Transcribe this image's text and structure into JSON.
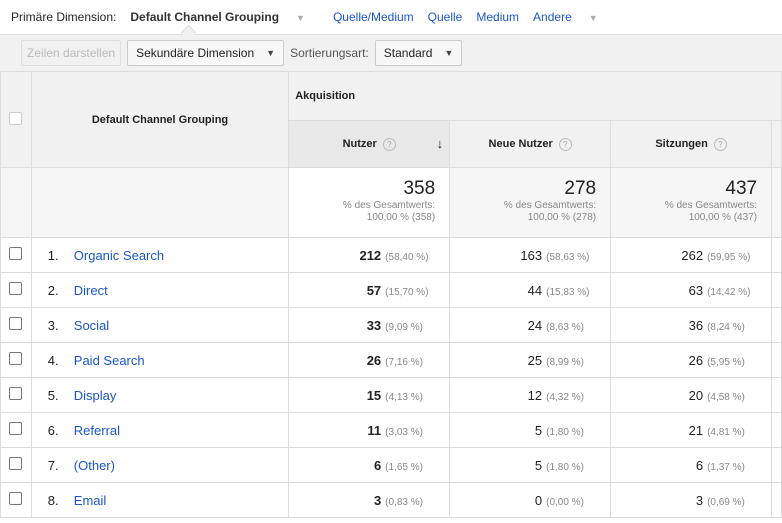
{
  "topbar": {
    "primary_label": "Primäre Dimension:",
    "active": "Default Channel Grouping",
    "links": [
      "Quelle/Medium",
      "Quelle",
      "Medium",
      "Andere"
    ]
  },
  "toolbar": {
    "show_rows": "Zeilen darstellen",
    "secondary": "Sekundäre Dimension",
    "sort_label": "Sortierungsart:",
    "sort_value": "Standard"
  },
  "table": {
    "dimension_header": "Default Channel Grouping",
    "group_header": "Akquisition",
    "columns": [
      "Nutzer",
      "Neue Nutzer",
      "Sitzungen"
    ],
    "totals": [
      {
        "value": "358",
        "label": "% des Gesamtwerts:",
        "pct": "100,00 % (358)"
      },
      {
        "value": "278",
        "label": "% des Gesamtwerts:",
        "pct": "100,00 % (278)"
      },
      {
        "value": "437",
        "label": "% des Gesamtwerts:",
        "pct": "100,00 % (437)"
      }
    ],
    "rows": [
      {
        "n": "1.",
        "name": "Organic Search",
        "c": [
          [
            "212",
            "(58,40 %)"
          ],
          [
            "163",
            "(58,63 %)"
          ],
          [
            "262",
            "(59,95 %)"
          ]
        ]
      },
      {
        "n": "2.",
        "name": "Direct",
        "c": [
          [
            "57",
            "(15,70 %)"
          ],
          [
            "44",
            "(15,83 %)"
          ],
          [
            "63",
            "(14,42 %)"
          ]
        ]
      },
      {
        "n": "3.",
        "name": "Social",
        "c": [
          [
            "33",
            "(9,09 %)"
          ],
          [
            "24",
            "(8,63 %)"
          ],
          [
            "36",
            "(8,24 %)"
          ]
        ]
      },
      {
        "n": "4.",
        "name": "Paid Search",
        "c": [
          [
            "26",
            "(7,16 %)"
          ],
          [
            "25",
            "(8,99 %)"
          ],
          [
            "26",
            "(5,95 %)"
          ]
        ]
      },
      {
        "n": "5.",
        "name": "Display",
        "c": [
          [
            "15",
            "(4,13 %)"
          ],
          [
            "12",
            "(4,32 %)"
          ],
          [
            "20",
            "(4,58 %)"
          ]
        ]
      },
      {
        "n": "6.",
        "name": "Referral",
        "c": [
          [
            "11",
            "(3,03 %)"
          ],
          [
            "5",
            "(1,80 %)"
          ],
          [
            "21",
            "(4,81 %)"
          ]
        ]
      },
      {
        "n": "7.",
        "name": "(Other)",
        "c": [
          [
            "6",
            "(1,65 %)"
          ],
          [
            "5",
            "(1,80 %)"
          ],
          [
            "6",
            "(1,37 %)"
          ]
        ]
      },
      {
        "n": "8.",
        "name": "Email",
        "c": [
          [
            "3",
            "(0,83 %)"
          ],
          [
            "0",
            "(0,00 %)"
          ],
          [
            "3",
            "(0,69 %)"
          ]
        ]
      }
    ]
  }
}
